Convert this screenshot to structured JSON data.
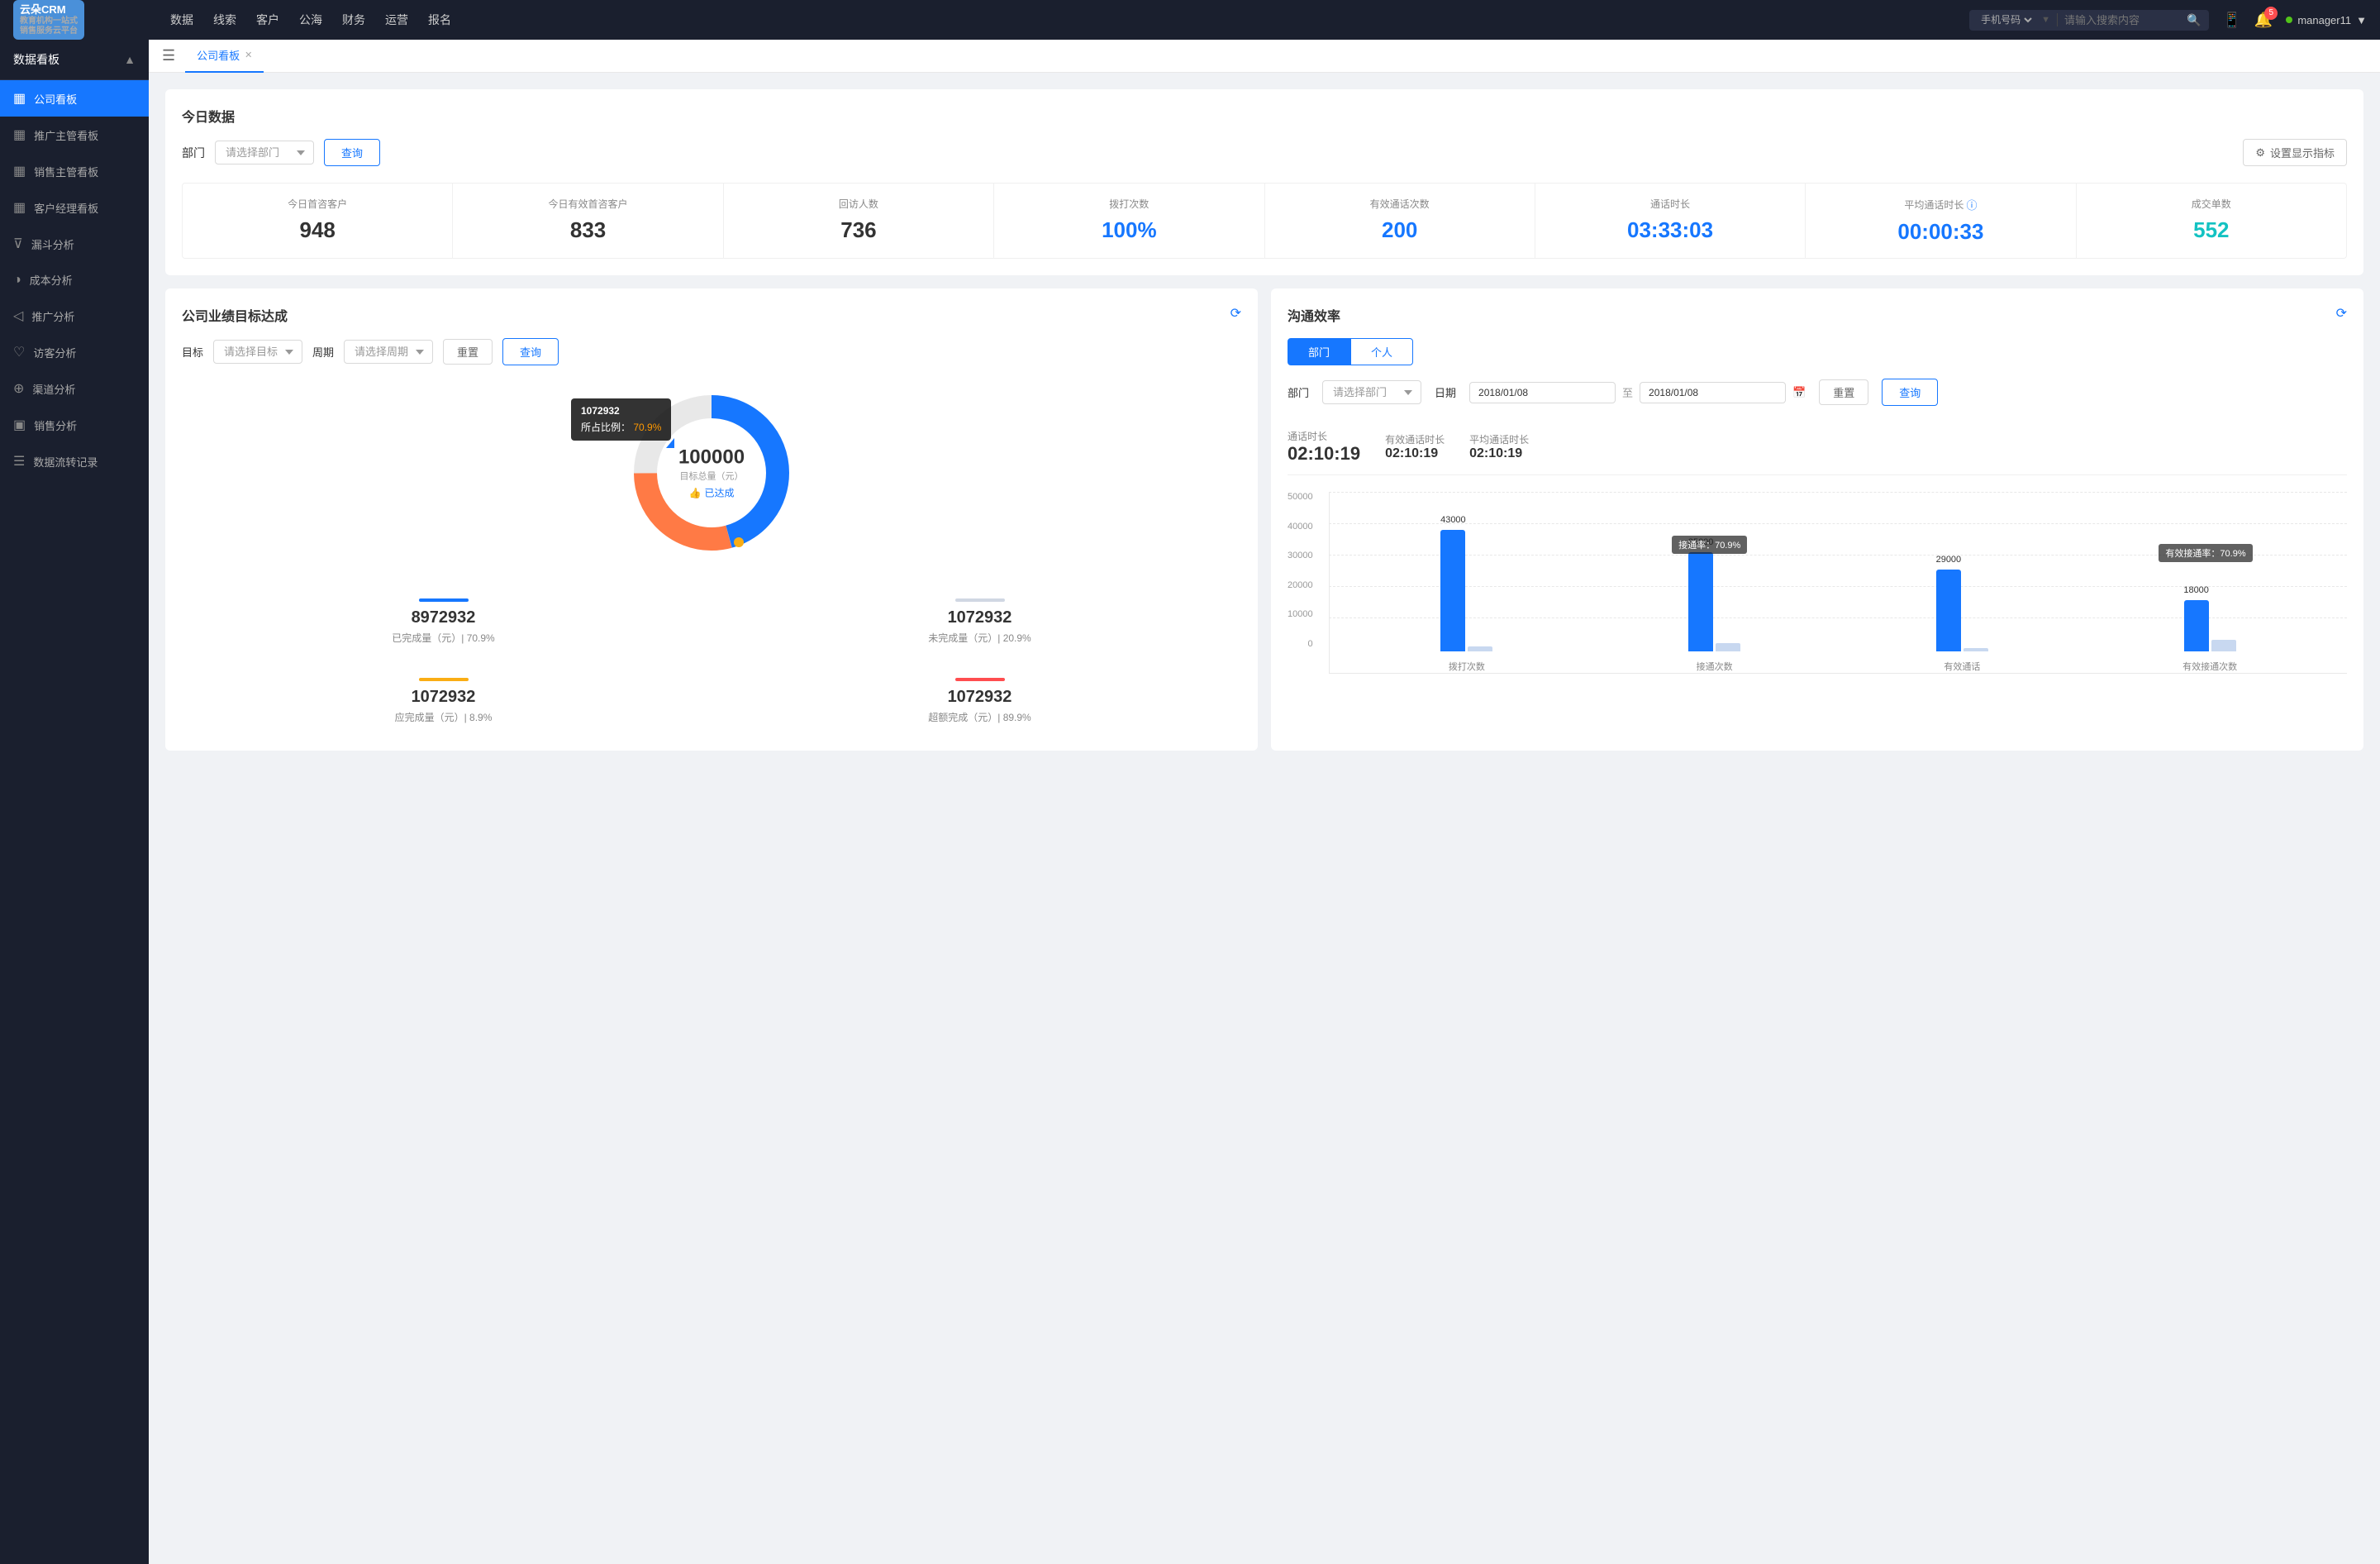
{
  "app": {
    "name": "云朵CRM",
    "subtitle1": "教育机构一站式",
    "subtitle2": "销售服务云平台"
  },
  "top_nav": {
    "items": [
      "数据",
      "线索",
      "客户",
      "公海",
      "财务",
      "运营",
      "报名"
    ],
    "search_placeholder": "请输入搜索内容",
    "search_type": "手机号码",
    "user": "manager11",
    "badge_count": "5"
  },
  "sidebar": {
    "title": "数据看板",
    "items": [
      {
        "id": "company",
        "label": "公司看板",
        "active": true,
        "icon": "▦"
      },
      {
        "id": "promo",
        "label": "推广主管看板",
        "active": false,
        "icon": "▦"
      },
      {
        "id": "sales",
        "label": "销售主管看板",
        "active": false,
        "icon": "▦"
      },
      {
        "id": "customer",
        "label": "客户经理看板",
        "active": false,
        "icon": "▦"
      },
      {
        "id": "funnel",
        "label": "漏斗分析",
        "active": false,
        "icon": "⊽"
      },
      {
        "id": "cost",
        "label": "成本分析",
        "active": false,
        "icon": "◑"
      },
      {
        "id": "promo2",
        "label": "推广分析",
        "active": false,
        "icon": "◁"
      },
      {
        "id": "visitor",
        "label": "访客分析",
        "active": false,
        "icon": "♡"
      },
      {
        "id": "channel",
        "label": "渠道分析",
        "active": false,
        "icon": "⊕"
      },
      {
        "id": "sales2",
        "label": "销售分析",
        "active": false,
        "icon": "▣"
      },
      {
        "id": "flow",
        "label": "数据流转记录",
        "active": false,
        "icon": "☰"
      }
    ]
  },
  "tab_bar": {
    "active_tab": "公司看板"
  },
  "today_data": {
    "section_title": "今日数据",
    "filter_label": "部门",
    "filter_placeholder": "请选择部门",
    "btn_query": "查询",
    "btn_settings": "设置显示指标",
    "stats": [
      {
        "label": "今日首咨客户",
        "value": "948",
        "color": "dark"
      },
      {
        "label": "今日有效首咨客户",
        "value": "833",
        "color": "dark"
      },
      {
        "label": "回访人数",
        "value": "736",
        "color": "dark"
      },
      {
        "label": "拨打次数",
        "value": "100%",
        "color": "blue"
      },
      {
        "label": "有效通话次数",
        "value": "200",
        "color": "blue"
      },
      {
        "label": "通话时长",
        "value": "03:33:03",
        "color": "blue"
      },
      {
        "label": "平均通话时长",
        "value": "00:00:33",
        "color": "blue"
      },
      {
        "label": "成交单数",
        "value": "552",
        "color": "cyan"
      }
    ]
  },
  "target_panel": {
    "title": "公司业绩目标达成",
    "target_label": "目标",
    "target_placeholder": "请选择目标",
    "period_label": "周期",
    "period_placeholder": "请选择周期",
    "btn_reset": "重置",
    "btn_query": "查询",
    "donut": {
      "center_value": "100000",
      "center_label": "目标总量（元）",
      "center_badge": "已达成",
      "tooltip_id": "1072932",
      "tooltip_pct_label": "所占比例：",
      "tooltip_pct": "70.9%"
    },
    "stats": [
      {
        "label": "已完成量（元）",
        "sub": "70.9%",
        "value": "8972932",
        "bar_color": "#1677ff"
      },
      {
        "label": "未完成量（元）",
        "sub": "20.9%",
        "value": "1072932",
        "bar_color": "#d0d7e3"
      },
      {
        "label": "应完成量（元）",
        "sub": "8.9%",
        "value": "1072932",
        "bar_color": "#faad14"
      },
      {
        "label": "超额完成（元）",
        "sub": "89.9%",
        "value": "1072932",
        "bar_color": "#ff4d4f"
      }
    ]
  },
  "efficiency_panel": {
    "title": "沟通效率",
    "tabs": [
      "部门",
      "个人"
    ],
    "active_tab": "部门",
    "dept_label": "部门",
    "dept_placeholder": "请选择部门",
    "date_label": "日期",
    "date_from": "2018/01/08",
    "date_to": "2018/01/08",
    "date_sep": "至",
    "btn_reset": "重置",
    "btn_query": "查询",
    "call_duration_label": "通话时长",
    "call_duration_value": "02:10:19",
    "eff_duration_label": "有效通话时长",
    "eff_duration_value": "02:10:19",
    "avg_duration_label": "平均通话时长",
    "avg_duration_value": "02:10:19",
    "chart": {
      "y_labels": [
        "50000",
        "40000",
        "30000",
        "20000",
        "10000",
        "0"
      ],
      "groups": [
        {
          "label": "拨打次数",
          "bars": [
            {
              "value": 43000,
              "pct_height": 86,
              "color": "blue",
              "label": "43000"
            },
            {
              "value": 0,
              "pct_height": 0,
              "color": "none"
            }
          ]
        },
        {
          "label": "接通次数",
          "rate_label": "接通率：70.9%",
          "bars": [
            {
              "value": 35000,
              "pct_height": 70,
              "color": "blue",
              "label": "35000"
            },
            {
              "value": 0,
              "pct_height": 2,
              "color": "light-blue"
            }
          ]
        },
        {
          "label": "有效通话",
          "bars": [
            {
              "value": 29000,
              "pct_height": 58,
              "color": "blue",
              "label": "29000"
            },
            {
              "value": 0,
              "pct_height": 0,
              "color": "none"
            }
          ]
        },
        {
          "label": "有效接通次数",
          "rate_label": "有效接通率：70.9%",
          "bars": [
            {
              "value": 18000,
              "pct_height": 36,
              "color": "blue",
              "label": "18000"
            },
            {
              "value": 4000,
              "pct_height": 4,
              "color": "light-blue"
            }
          ]
        }
      ]
    }
  }
}
